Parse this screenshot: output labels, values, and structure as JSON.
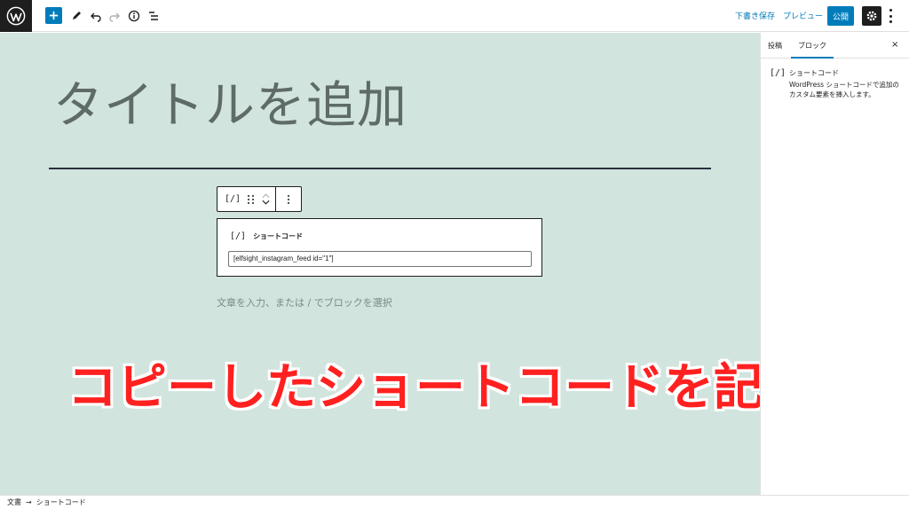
{
  "toolbar": {
    "save_draft_label": "下書き保存",
    "preview_label": "プレビュー",
    "publish_label": "公開"
  },
  "canvas": {
    "title_placeholder": "タイトルを追加",
    "appender_placeholder": "文章を入力、または / でブロックを選択"
  },
  "shortcode_block": {
    "icon_glyph": "[/]",
    "label": "ショートコード",
    "value": "[elfsight_instagram_feed id=\"1\"]"
  },
  "overlay": {
    "caption": "コピーしたショートコードを記載",
    "color": "#ff2020"
  },
  "sidebar": {
    "tabs": [
      {
        "label": "投稿"
      },
      {
        "label": "ブロック"
      }
    ],
    "active_tab": "ブロック",
    "close_glyph": "×",
    "card": {
      "icon_glyph": "[/]",
      "title": "ショートコード",
      "description": "WordPress ショートコードで追加のカスタム要素を挿入します。"
    }
  },
  "breadcrumb": {
    "items": [
      "文書",
      "ショートコード"
    ],
    "separator": "→"
  },
  "colors": {
    "accent": "#007cba",
    "canvas_bg": "#d1e4dd",
    "dark": "#1e1e1e"
  },
  "icons": [
    "wordpress-logo-icon",
    "plus-icon",
    "pencil-icon",
    "undo-icon",
    "redo-icon",
    "info-icon",
    "list-view-icon",
    "gear-icon",
    "more-vertical-icon",
    "drag-handle-icon",
    "chevron-up-icon",
    "chevron-down-icon",
    "close-icon",
    "shortcode-icon",
    "arrow-right-icon"
  ]
}
